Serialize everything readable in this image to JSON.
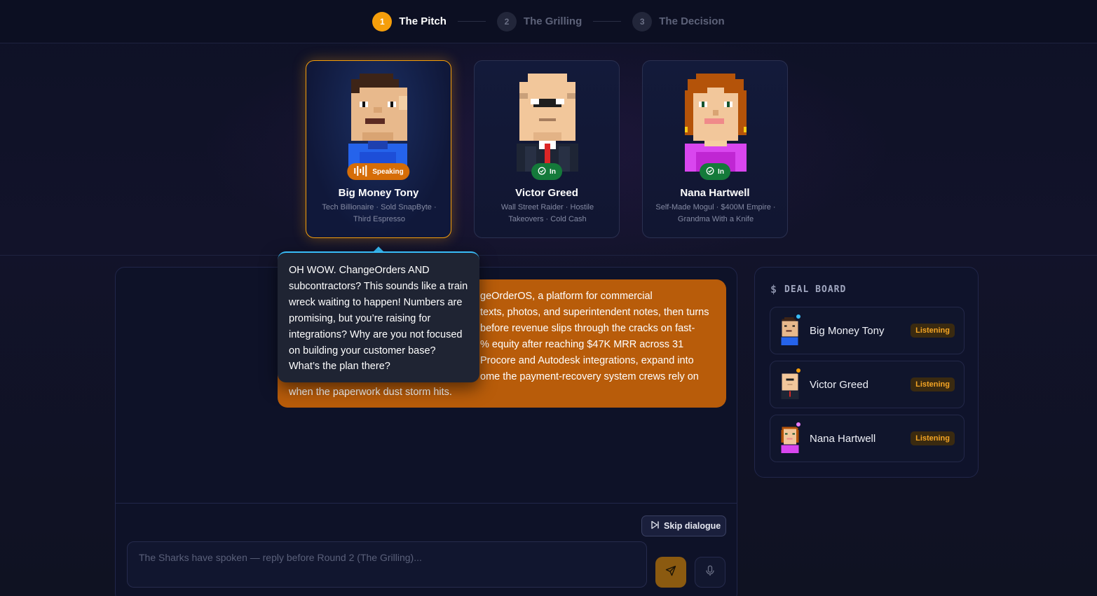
{
  "stepper": {
    "steps": [
      {
        "num": "1",
        "label": "The Pitch"
      },
      {
        "num": "2",
        "label": "The Grilling"
      },
      {
        "num": "3",
        "label": "The Decision"
      }
    ]
  },
  "sharks": [
    {
      "name": "Big Money Tony",
      "desc": "Tech Billionaire · Sold SnapByte · Third Espresso",
      "badge": "Speaking"
    },
    {
      "name": "Victor Greed",
      "desc": "Wall Street Raider · Hostile Takeovers · Cold Cash",
      "badge": "In"
    },
    {
      "name": "Nana Hartwell",
      "desc": "Self-Made Mogul · $400M Empire · Grandma With a Knife",
      "badge": "In"
    }
  ],
  "speech": {
    "text": "OH WOW. ChangeOrders AND subcontractors? This sounds like a train wreck waiting to happen! Numbers are promising, but you’re raising for integrations? Why are you not focused on building your customer base? What’s the plan there?"
  },
  "chat": {
    "pitch_text": "ChangeOrderOS, a platform for commercial texts, photos, and superintendent notes, then turns before revenue slips through the cracks on fast- % equity after reaching $47K MRR across 31 Procore and Autodesk integrations, expand into ome the payment-recovery system crews rely on when the paperwork dust storm hits.",
    "pitch_lines": [
      "geOrderOS, a platform for commercial",
      "texts, photos, and superintendent notes, then turns",
      "before revenue slips through the cracks on fast-",
      "% equity after reaching $47K MRR across 31",
      "Procore and Autodesk integrations, expand into",
      "ome the payment-recovery system crews rely on",
      "when the paperwork dust storm hits."
    ],
    "skip_label": "Skip dialogue",
    "input_placeholder": "The Sharks have spoken — reply before Round 2 (The Grilling)..."
  },
  "deal_board": {
    "title": "DEAL BOARD",
    "rows": [
      {
        "name": "Big Money Tony",
        "status": "Listening",
        "dot_color": "#38bdf8"
      },
      {
        "name": "Victor Greed",
        "status": "Listening",
        "dot_color": "#f59e0b"
      },
      {
        "name": "Nana Hartwell",
        "status": "Listening",
        "dot_color": "#e879f9"
      }
    ]
  },
  "colors": {
    "accent": "#f59e0b",
    "pitch_bubble": "#b85c0a",
    "speaking_badge": "#d66d07",
    "in_badge": "#147a3a",
    "listening_text": "#f5a524"
  }
}
